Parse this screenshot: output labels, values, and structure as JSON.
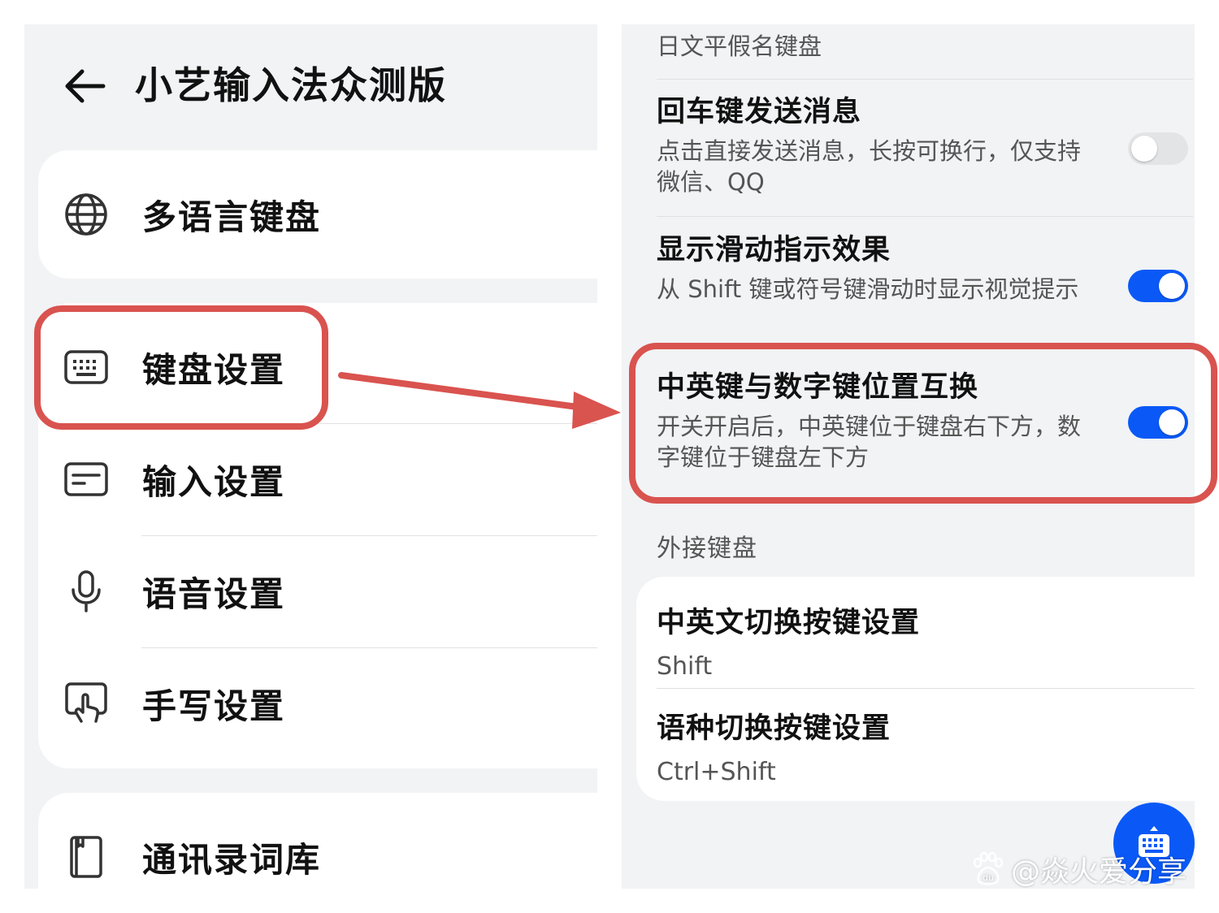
{
  "left": {
    "title": "小艺输入法众测版",
    "items": [
      {
        "label": "多语言键盘",
        "icon": "globe-icon"
      },
      {
        "label": "键盘设置",
        "icon": "keyboard-icon"
      },
      {
        "label": "输入设置",
        "icon": "input-box-icon"
      },
      {
        "label": "语音设置",
        "icon": "microphone-icon"
      },
      {
        "label": "手写设置",
        "icon": "handwriting-icon"
      },
      {
        "label": "通讯录词库",
        "icon": "contacts-book-icon"
      }
    ]
  },
  "right": {
    "partial_text": "日文平假名键盘",
    "options": [
      {
        "title": "回车键发送消息",
        "desc": "点击直接发送消息，长按可换行，仅支持微信、QQ",
        "enabled": false
      },
      {
        "title": "显示滑动指示效果",
        "desc": "从 Shift 键或符号键滑动时显示视觉提示",
        "enabled": true
      },
      {
        "title": "中英键与数字键位置互换",
        "desc": "开关开启后，中英键位于键盘右下方，数字键位于键盘左下方",
        "enabled": true
      }
    ],
    "section_header": "外接键盘",
    "external": [
      {
        "title": "中英文切换按键设置",
        "value": "Shift"
      },
      {
        "title": "语种切换按键设置",
        "value": "Ctrl+Shift"
      }
    ],
    "fab_icon": "keyboard-icon"
  },
  "watermark": {
    "text": "@焱火爱分享",
    "logo": "du"
  },
  "colors": {
    "accent": "#0a59f7",
    "highlight": "#d9534f",
    "background": "#f1f3f5"
  }
}
